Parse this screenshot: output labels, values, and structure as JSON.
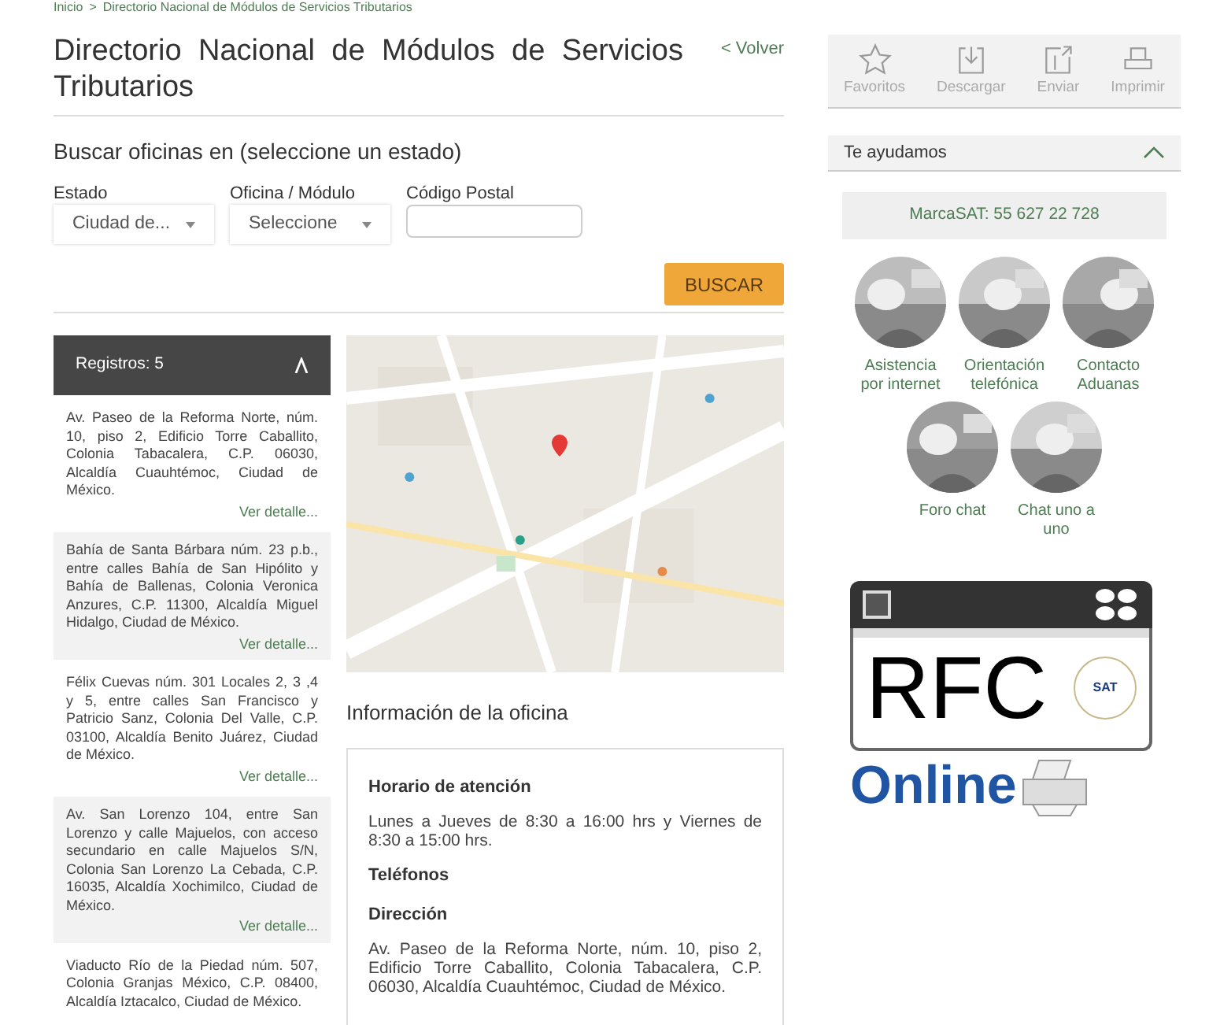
{
  "breadcrumb": {
    "home": "Inicio",
    "separator": ">",
    "current": "Directorio Nacional de Módulos de Servicios Tributarios"
  },
  "title": "Directorio Nacional de Módulos de Servicios Tributarios",
  "back_link": "< Volver",
  "search": {
    "heading": "Buscar oficinas en (seleccione un estado)",
    "fields": [
      {
        "kind": "select",
        "label": "Estado",
        "value": "Ciudad de..."
      },
      {
        "kind": "select",
        "label": "Oficina / Módulo",
        "value": "Seleccione"
      },
      {
        "kind": "text",
        "label": "Código Postal"
      }
    ],
    "button": "BUSCAR"
  },
  "results": {
    "header": "Registros: 5",
    "expanded": true,
    "items": [
      {
        "address": "Av. Paseo de la Reforma Norte, núm. 10, piso 2, Edificio Torre Caballito, Colonia Tabacalera, C.P. 06030, Alcaldía Cuauhtémoc, Ciudad de México.",
        "link": "Ver detalle..."
      },
      {
        "address": "Bahía de Santa Bárbara núm. 23 p.b., entre calles Bahía de San Hipólito y Bahía de Ballenas, Colonia Veronica Anzures, C.P. 11300, Alcaldía Miguel Hidalgo, Ciudad de México.",
        "link": "Ver detalle..."
      },
      {
        "address": "Félix Cuevas núm. 301 Locales 2, 3 ,4 y 5, entre calles San Francisco y Patricio Sanz, Colonia Del Valle, C.P. 03100, Alcaldía Benito Juárez, Ciudad de México.",
        "link": "Ver detalle..."
      },
      {
        "address": "Av. San Lorenzo 104, entre San Lorenzo y calle Majuelos, con acceso secundario en calle Majuelos S/N, Colonia San Lorenzo La Cebada, C.P. 16035, Alcaldía Xochimilco, Ciudad de México.",
        "link": "Ver detalle..."
      },
      {
        "address": "Viaducto Río de la Piedad núm. 507, Colonia Granjas México, C.P. 08400, Alcaldía Iztacalco, Ciudad de México."
      }
    ]
  },
  "office_info": {
    "title": "Información de la oficina",
    "sections": [
      {
        "heading": "Horario de atención",
        "text": "Lunes a Jueves de 8:30 a 16:00 hrs y Viernes de 8:30 a 15:00 hrs."
      },
      {
        "heading": "Teléfonos"
      },
      {
        "heading": "Dirección",
        "text": "Av. Paseo de la Reforma Norte, núm. 10, piso 2, Edificio Torre Caballito, Colonia Tabacalera, C.P. 06030,  Alcaldía Cuauhtémoc, Ciudad de México."
      }
    ]
  },
  "toolbar": [
    {
      "kind": "star",
      "label": "Favoritos"
    },
    {
      "kind": "download",
      "label": "Descargar"
    },
    {
      "kind": "send",
      "label": "Enviar"
    },
    {
      "kind": "print",
      "label": "Imprimir"
    }
  ],
  "help": {
    "title": "Te ayudamos",
    "expanded": true,
    "phone": "MarcaSAT: 55 627 22 728",
    "services": [
      {
        "label": "Asistencia por internet"
      },
      {
        "label": "Orientación telefónica"
      },
      {
        "label": "Contacto Aduanas"
      },
      {
        "label": "Foro chat"
      },
      {
        "label": "Chat uno a uno"
      }
    ]
  },
  "banner": {
    "title": "RFC",
    "badge": "SAT",
    "subtitle": "Online"
  }
}
